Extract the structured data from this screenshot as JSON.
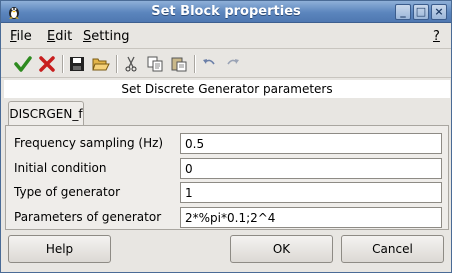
{
  "window": {
    "title": "Set Block properties",
    "controls": {
      "minimize": "_",
      "maximize": "□",
      "close": "×"
    }
  },
  "menubar": {
    "items": [
      {
        "label": "File",
        "mnemonic": "F"
      },
      {
        "label": "Edit",
        "mnemonic": "E"
      },
      {
        "label": "Setting",
        "mnemonic": "S"
      }
    ],
    "help": "?"
  },
  "toolbar": {
    "icons": [
      "check-icon",
      "cancel-x-icon",
      "save-icon",
      "open-folder-icon",
      "cut-icon",
      "copy-icon",
      "paste-icon",
      "undo-icon",
      "redo-icon"
    ],
    "colors": {
      "ok_green": "#2e8b20",
      "cancel_red": "#c81e1e"
    }
  },
  "header": {
    "text": "Set Discrete Generator parameters"
  },
  "tab": {
    "label": "DISCRGEN_f"
  },
  "fields": [
    {
      "label": "Frequency sampling (Hz)",
      "value": "0.5"
    },
    {
      "label": "Initial condition",
      "value": "0"
    },
    {
      "label": "Type of generator",
      "value": "1"
    },
    {
      "label": "Parameters of generator",
      "value": "2*%pi*0.1;2^4"
    }
  ],
  "buttons": {
    "help": "Help",
    "ok": "OK",
    "cancel": "Cancel"
  }
}
